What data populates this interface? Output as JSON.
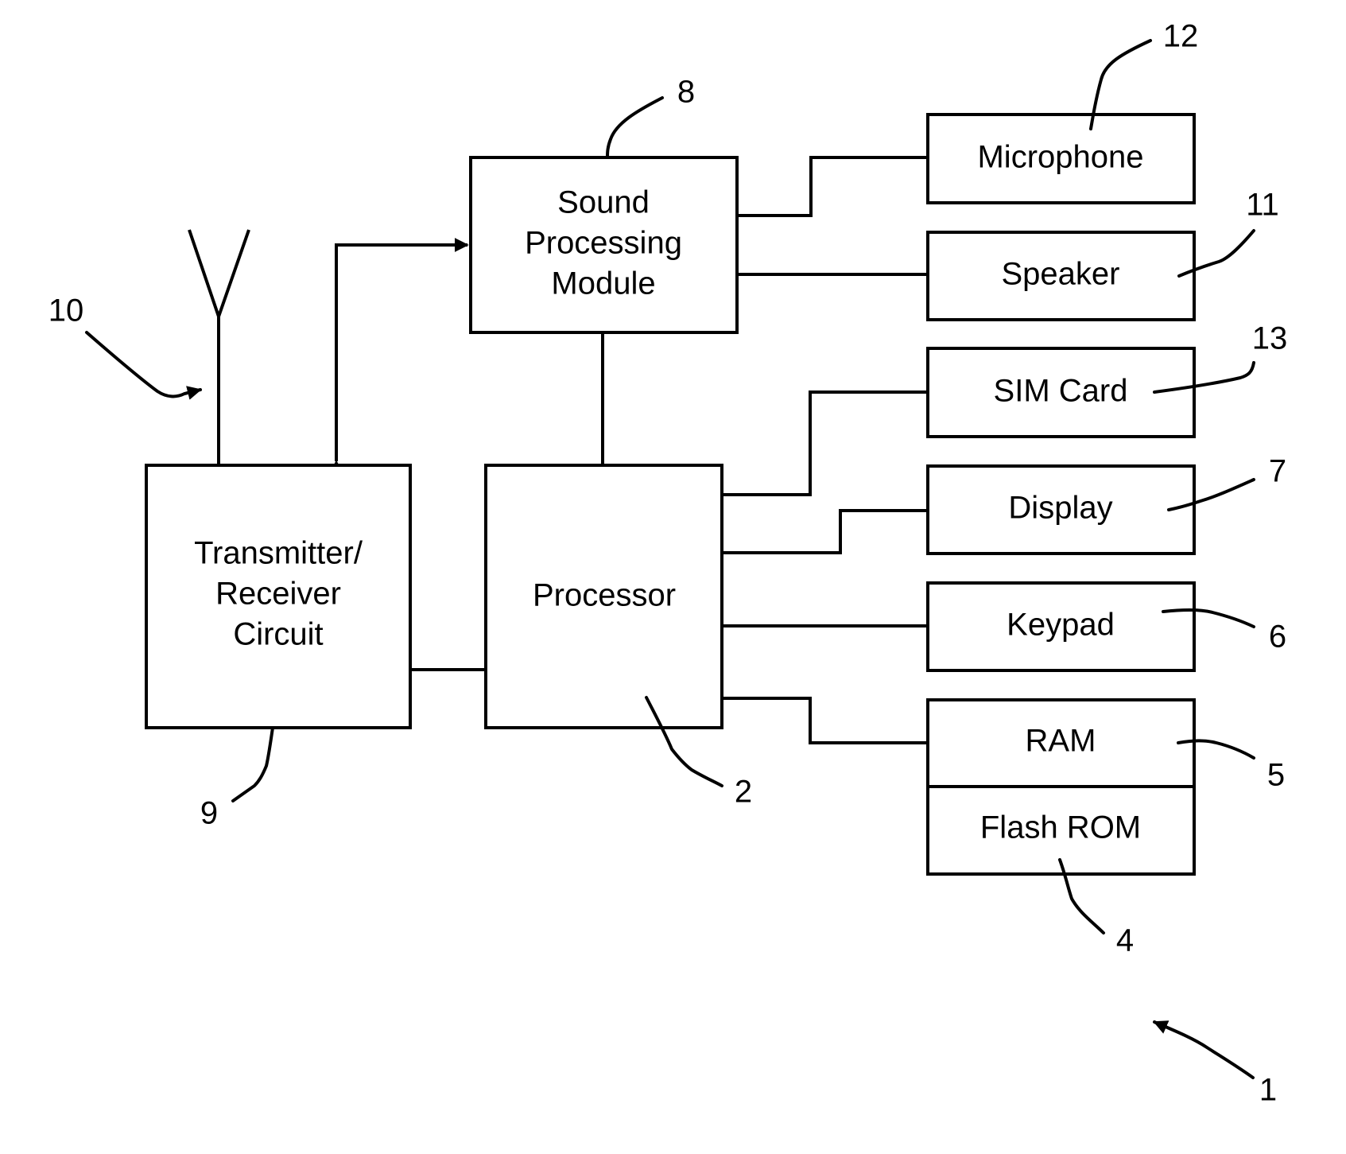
{
  "figure": {
    "blocks": {
      "sound_processing_module": {
        "lines": [
          "Sound",
          "Processing",
          "Module"
        ],
        "ref": "8"
      },
      "transmitter_receiver": {
        "lines": [
          "Transmitter/",
          "Receiver",
          "Circuit"
        ],
        "ref": "9"
      },
      "processor": {
        "lines": [
          "Processor"
        ],
        "ref": "2"
      },
      "microphone": {
        "lines": [
          "Microphone"
        ],
        "ref": "12"
      },
      "speaker": {
        "lines": [
          "Speaker"
        ],
        "ref": "11"
      },
      "sim_card": {
        "lines": [
          "SIM Card"
        ],
        "ref": "13"
      },
      "display": {
        "lines": [
          "Display"
        ],
        "ref": "7"
      },
      "keypad": {
        "lines": [
          "Keypad"
        ],
        "ref": "6"
      },
      "ram": {
        "lines": [
          "RAM"
        ],
        "ref": "5"
      },
      "flash_rom": {
        "lines": [
          "Flash ROM"
        ],
        "ref": "4"
      }
    },
    "antenna": {
      "ref": "10"
    },
    "device": {
      "ref": "1"
    },
    "connections": [
      {
        "from": "transmitter_receiver",
        "to": "sound_processing_module",
        "type": "bidirectional-arrow"
      },
      {
        "from": "transmitter_receiver",
        "to": "processor",
        "type": "line"
      },
      {
        "from": "antenna",
        "to": "transmitter_receiver",
        "type": "line"
      },
      {
        "from": "sound_processing_module",
        "to": "processor",
        "type": "line"
      },
      {
        "from": "sound_processing_module",
        "to": "microphone",
        "type": "line"
      },
      {
        "from": "sound_processing_module",
        "to": "speaker",
        "type": "line"
      },
      {
        "from": "processor",
        "to": "sim_card",
        "type": "line"
      },
      {
        "from": "processor",
        "to": "display",
        "type": "line"
      },
      {
        "from": "processor",
        "to": "keypad",
        "type": "line"
      },
      {
        "from": "processor",
        "to": "ram",
        "type": "line"
      }
    ]
  }
}
